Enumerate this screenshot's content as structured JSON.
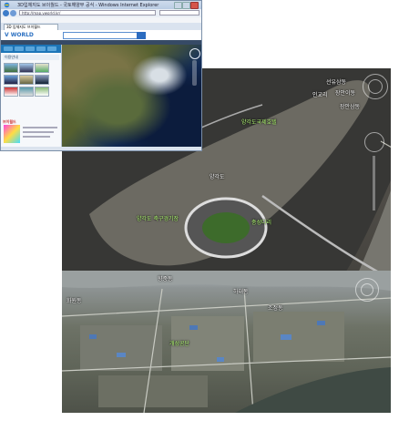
{
  "browser": {
    "window_title": "3D입체지도 브이월드 - 국토해양부 공식 - Windows Internet Explorer",
    "address": "http://map.vworld.kr/",
    "menu": [
      "파일(F)",
      "편집(E)",
      "보기(V)",
      "즐겨찾기(A)",
      "도구(T)",
      "도움말(H)"
    ],
    "tab_label": "3D 입체지도 브이월드"
  },
  "site": {
    "logo": "V WORLD",
    "subtitle": "국토해양부",
    "panel_header": "이용안내",
    "panel_section": "브이월드"
  },
  "view1": {
    "labels_white": [
      "선유삼동",
      "인교리",
      "장안이동",
      "장안삼동",
      "양각도"
    ],
    "labels_green": [
      "양각도국제호텔",
      "양각도 축구경기장",
      "충성다리"
    ]
  },
  "view2": {
    "labels_white": [
      "향중동",
      "하대동",
      "화원동",
      "조정동"
    ],
    "labels_green": [
      "개성공단"
    ]
  },
  "colors": {
    "accent": "#2a6fc1",
    "label_green": "#b8ff7a",
    "river": "#3a3a38"
  }
}
